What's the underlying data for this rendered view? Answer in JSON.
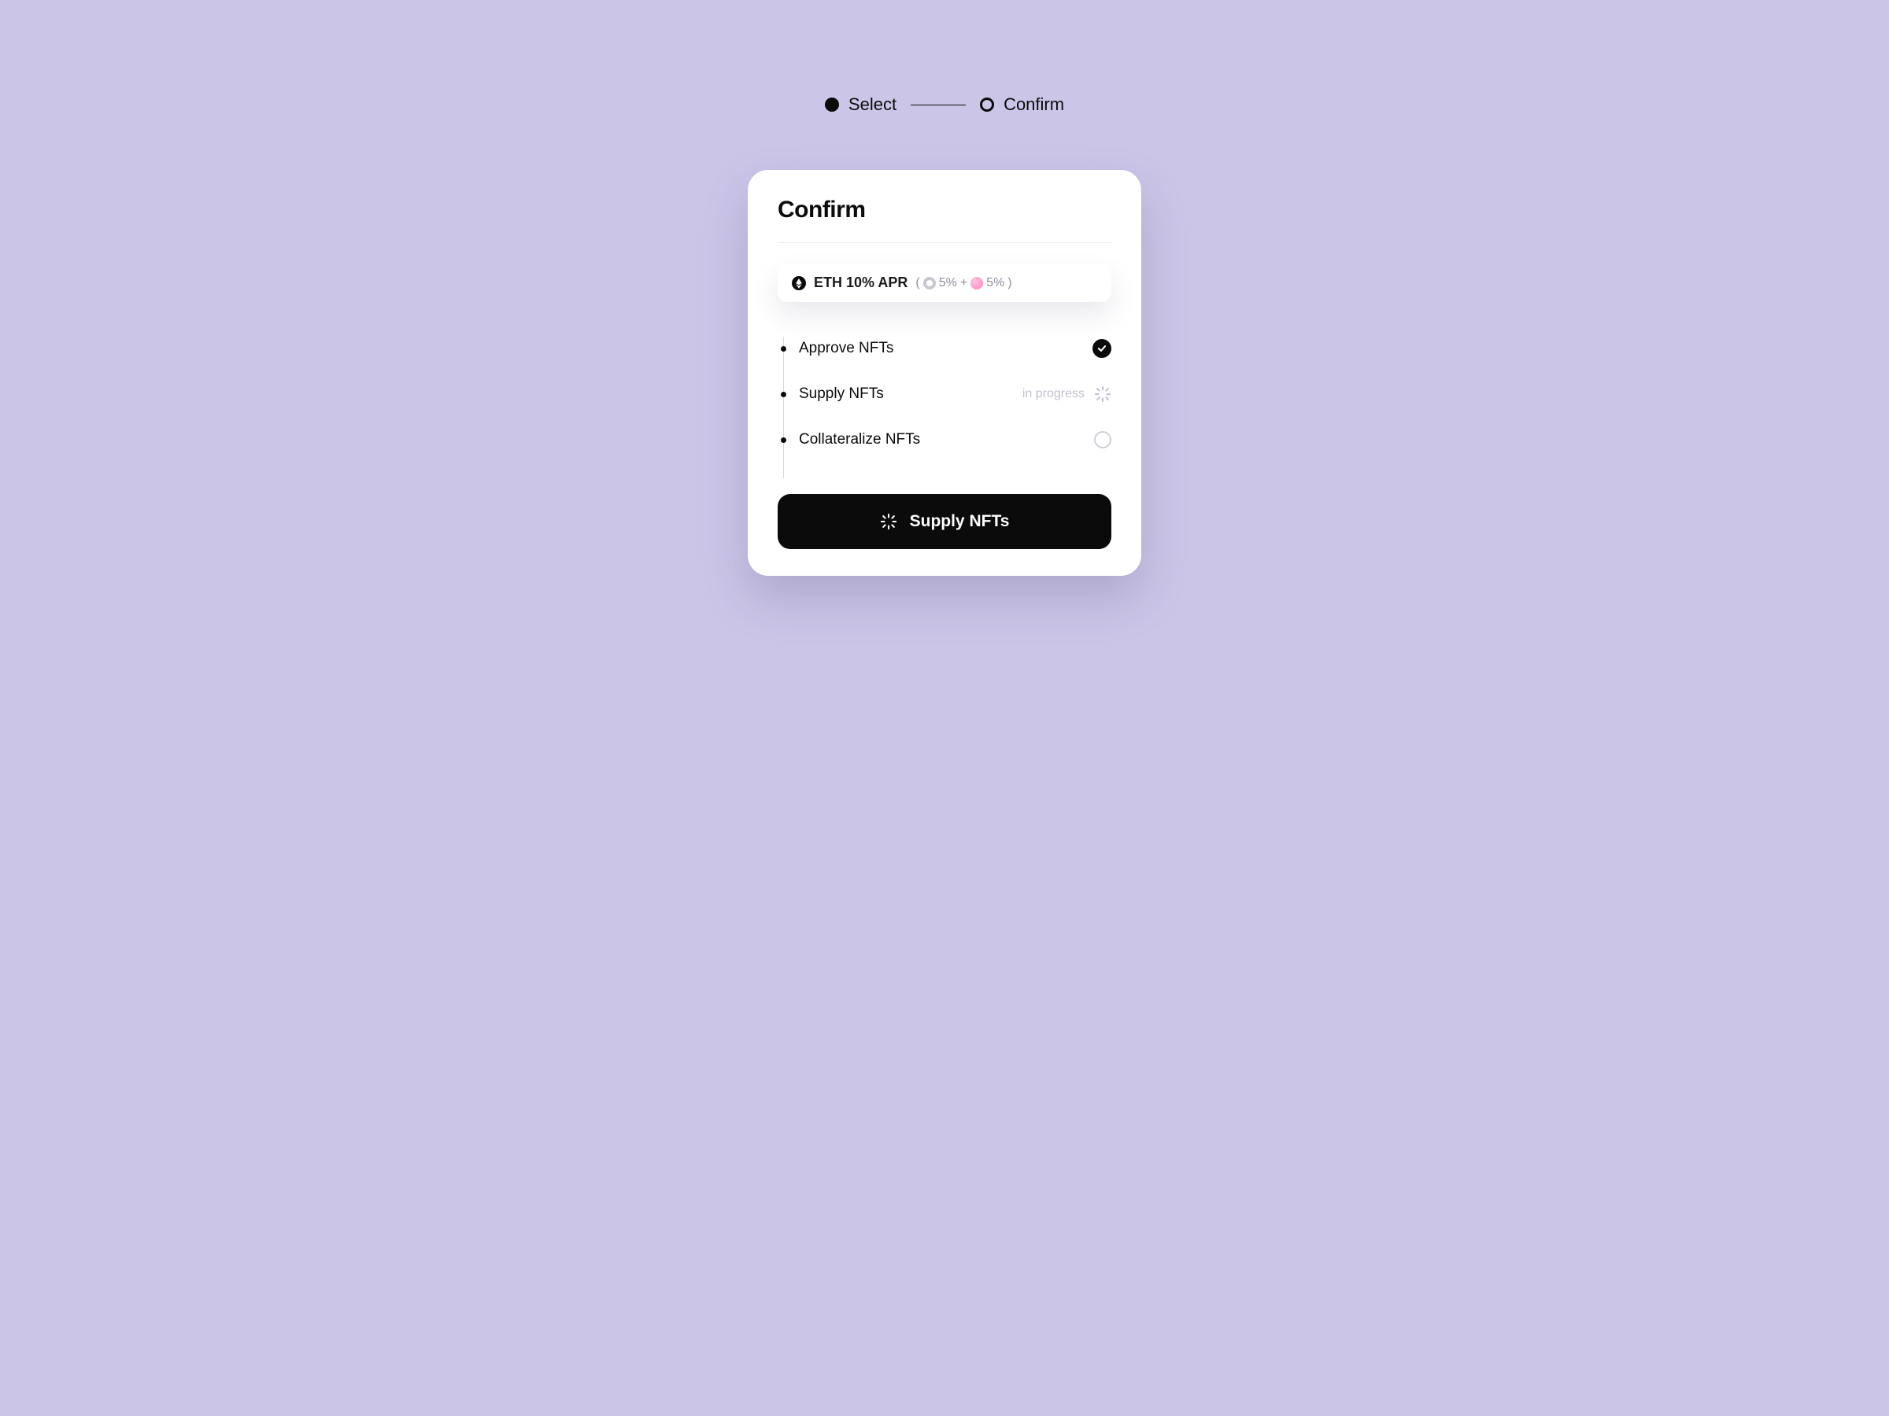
{
  "stepper": {
    "steps": [
      "Select",
      "Confirm"
    ],
    "activeIndex": 0
  },
  "card": {
    "title": "Confirm"
  },
  "apr": {
    "assetLabel": "ETH 10% APR",
    "part1": "5%",
    "plus": "+",
    "part2": "5%"
  },
  "txSteps": [
    {
      "label": "Approve NFTs",
      "status": "done"
    },
    {
      "label": "Supply NFTs",
      "status": "in_progress",
      "statusText": "in progress"
    },
    {
      "label": "Collateralize NFTs",
      "status": "pending"
    }
  ],
  "cta": {
    "label": "Supply NFTs"
  }
}
